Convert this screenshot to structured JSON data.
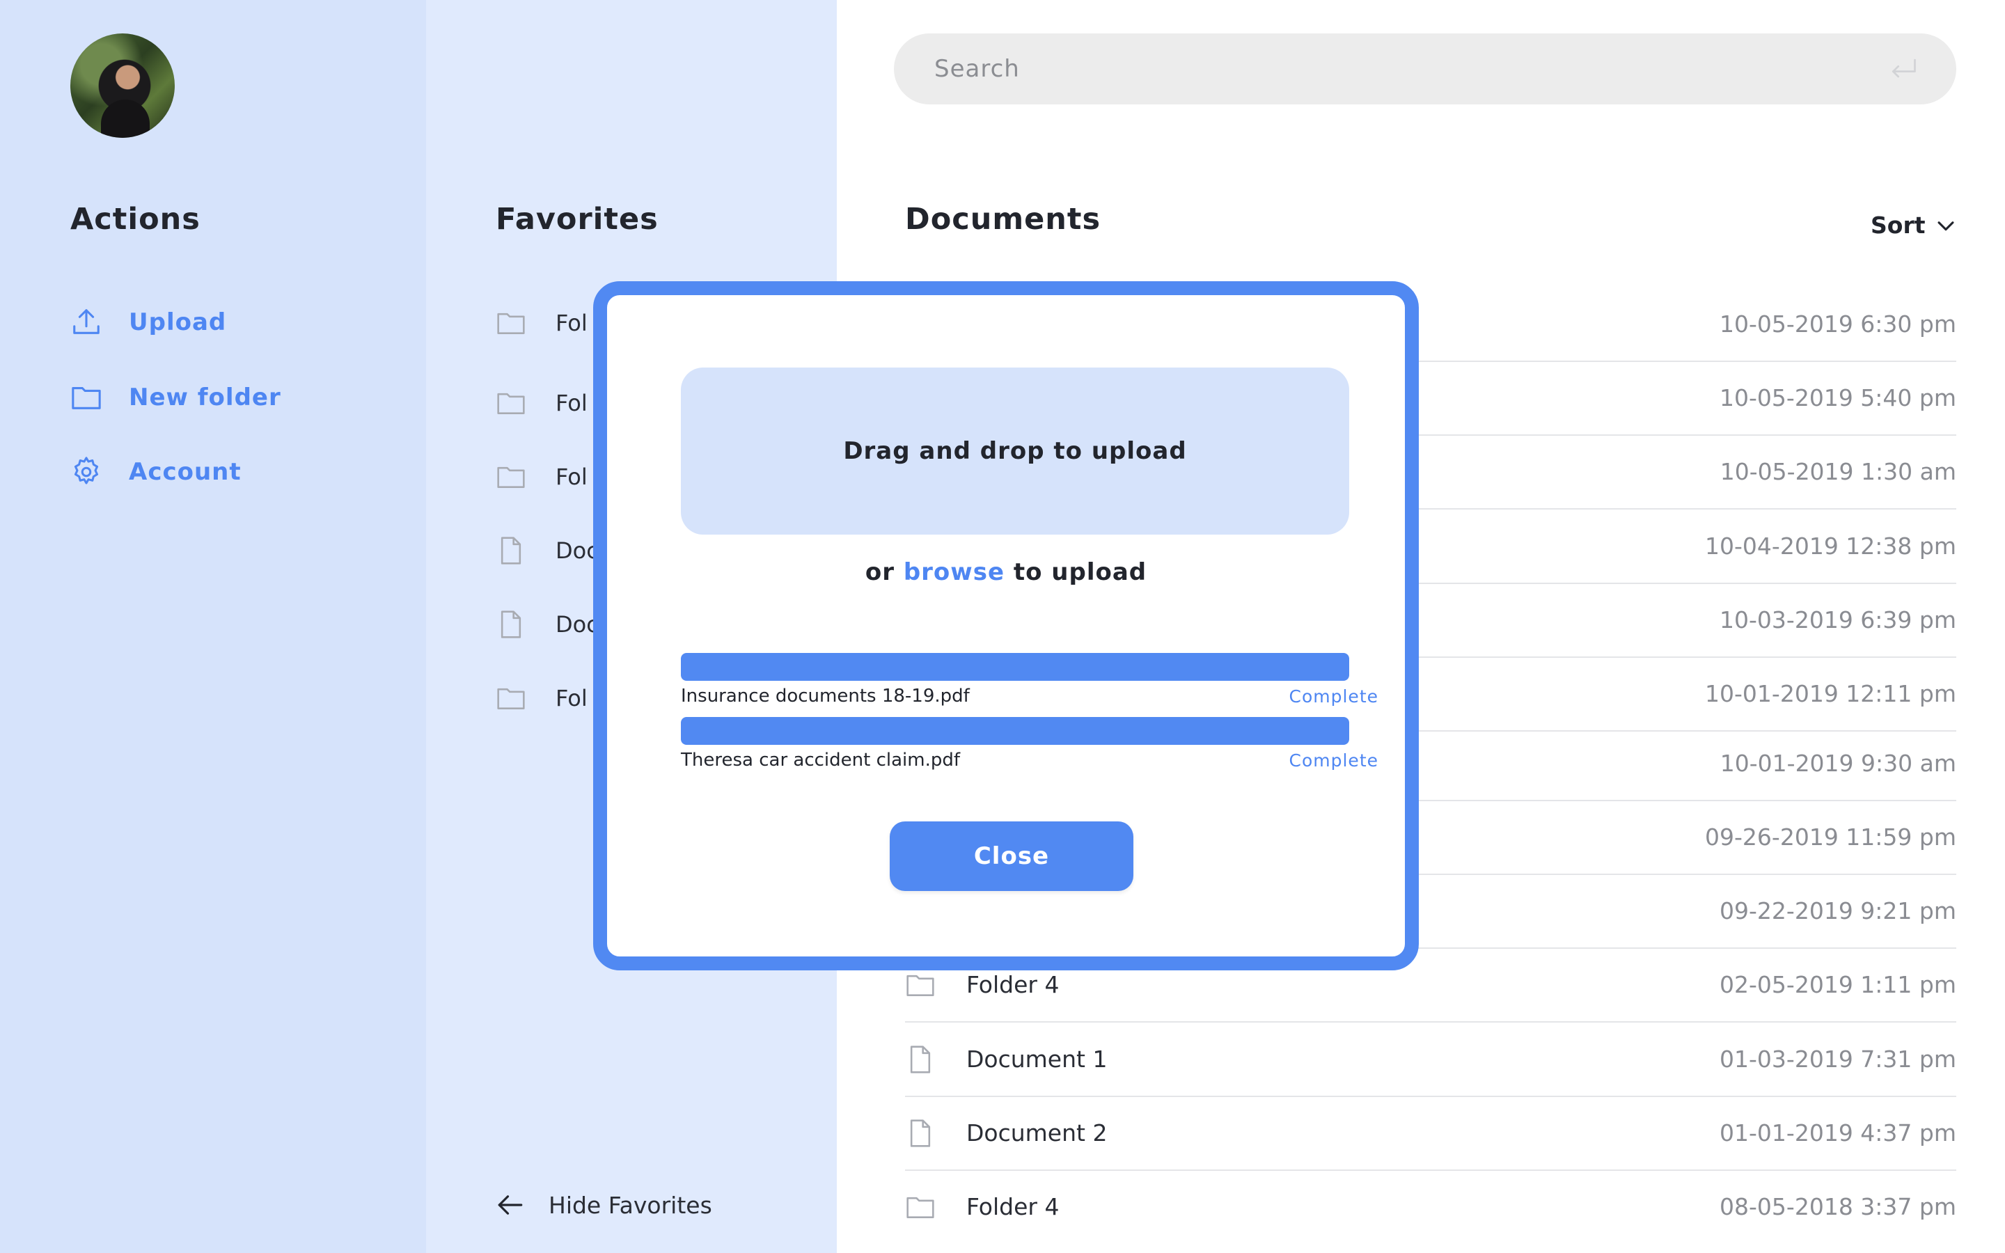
{
  "sidebar": {
    "title": "Actions",
    "items": [
      {
        "label": "Upload",
        "icon": "upload-icon"
      },
      {
        "label": "New folder",
        "icon": "folder-icon"
      },
      {
        "label": "Account",
        "icon": "gear-icon"
      }
    ]
  },
  "favorites": {
    "title": "Favorites",
    "items": [
      {
        "label": "Fol",
        "icon": "folder-icon"
      },
      {
        "label": "Fol",
        "icon": "folder-icon"
      },
      {
        "label": "Fol",
        "icon": "folder-icon"
      },
      {
        "label": "Doc",
        "icon": "document-icon"
      },
      {
        "label": "Doc",
        "icon": "document-icon"
      },
      {
        "label": "Fol",
        "icon": "folder-icon"
      }
    ],
    "hide_label": "Hide Favorites"
  },
  "search": {
    "placeholder": "Search"
  },
  "documents": {
    "title": "Documents",
    "sort_label": "Sort",
    "rows": [
      {
        "name": "",
        "date": "10-05-2019 6:30 pm",
        "icon": ""
      },
      {
        "name": "",
        "date": "10-05-2019 5:40 pm",
        "icon": ""
      },
      {
        "name": "",
        "date": "10-05-2019 1:30 am",
        "icon": ""
      },
      {
        "name": "",
        "date": "10-04-2019 12:38 pm",
        "icon": ""
      },
      {
        "name": "",
        "date": "10-03-2019 6:39 pm",
        "icon": ""
      },
      {
        "name": "",
        "date": "10-01-2019 12:11 pm",
        "icon": ""
      },
      {
        "name": "",
        "date": "10-01-2019 9:30 am",
        "icon": ""
      },
      {
        "name": "",
        "date": "09-26-2019 11:59 pm",
        "icon": ""
      },
      {
        "name": "",
        "date": "09-22-2019 9:21 pm",
        "icon": ""
      },
      {
        "name": "Folder 4",
        "date": "02-05-2019 1:11 pm",
        "icon": "folder-icon"
      },
      {
        "name": "Document 1",
        "date": "01-03-2019 7:31 pm",
        "icon": "document-icon"
      },
      {
        "name": "Document 2",
        "date": "01-01-2019 4:37 pm",
        "icon": "document-icon"
      },
      {
        "name": "Folder 4",
        "date": "08-05-2018 3:37 pm",
        "icon": "folder-icon"
      }
    ]
  },
  "modal": {
    "dropzone_label": "Drag and drop to upload",
    "browse_prefix": "or ",
    "browse_link": "browse",
    "browse_suffix": " to upload",
    "uploads": [
      {
        "file": "Insurance documents 18-19.pdf",
        "status": "Complete",
        "progress": 1.0
      },
      {
        "file": "Theresa car accident claim.pdf",
        "status": "Complete",
        "progress": 1.0
      }
    ],
    "close_label": "Close"
  },
  "colors": {
    "accent": "#5189f2",
    "actions_panel_bg": "#d6e3fb",
    "favorites_panel_bg": "#e0eafd",
    "search_bg": "#ececec"
  }
}
